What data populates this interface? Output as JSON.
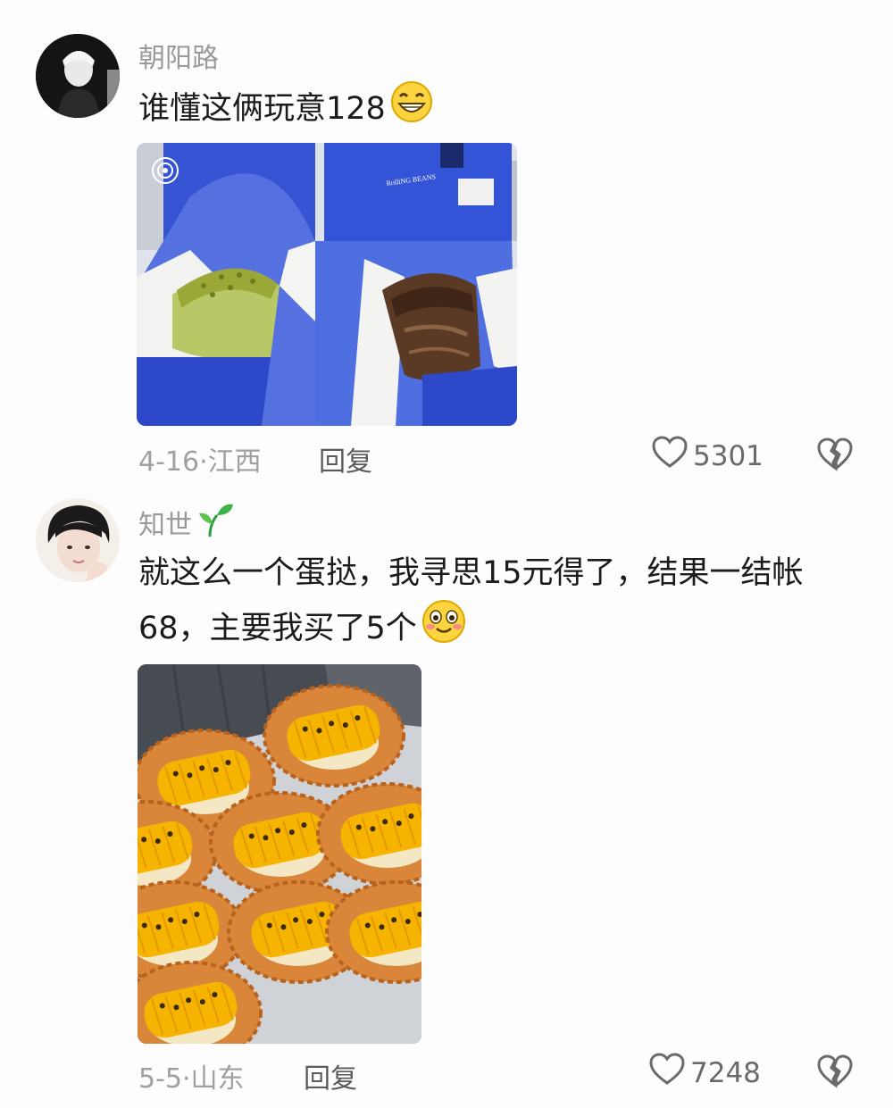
{
  "comments": [
    {
      "username": "朝阳路",
      "text": "谁懂这俩玩意128",
      "emoji": "grinning-face",
      "image_label": "RolliNG BEANS",
      "date": "4-16",
      "location": "江西",
      "reply_label": "回复",
      "likes": "5301"
    },
    {
      "username": "知世",
      "badge": "seedling-icon",
      "text_line1": "就这么一个蛋挞，我寻思15元得了，结果一结帐",
      "text_line2": "68，主要我买了5个",
      "emoji": "flushed-smile-face",
      "date": "5-5",
      "location": "山东",
      "reply_label": "回复",
      "likes": "7248"
    }
  ],
  "separator": "·",
  "colors": {
    "meta": "#a0a0a0",
    "username": "#9a9a9a",
    "box_blue": "#3a57d6",
    "corn": "#f6b400"
  }
}
